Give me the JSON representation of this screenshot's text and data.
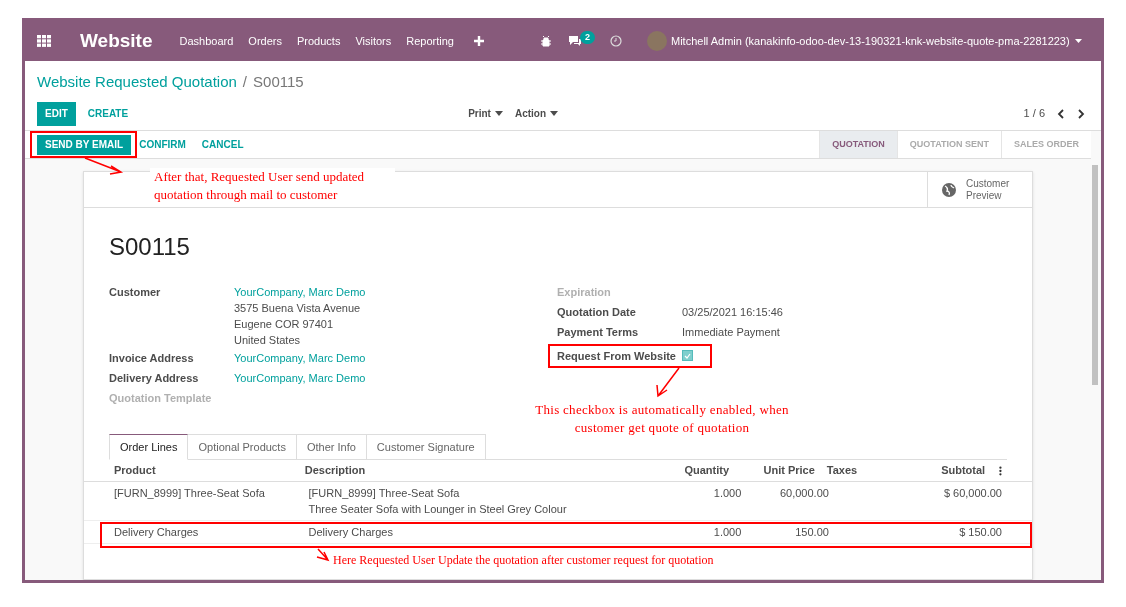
{
  "navbar": {
    "app_name": "Website",
    "menu": [
      "Dashboard",
      "Orders",
      "Products",
      "Visitors",
      "Reporting"
    ],
    "messages_count": "2",
    "user": "Mitchell Admin (kanakinfo-odoo-dev-13-190321-knk-website-quote-pma-2281223)"
  },
  "breadcrumb": {
    "parent": "Website Requested Quotation",
    "separator": "/",
    "current": "S00115"
  },
  "control_panel": {
    "primary": "EDIT",
    "secondary": "CREATE",
    "dropdowns": [
      "Print",
      "Action"
    ],
    "pager": "1 / 6"
  },
  "actions": [
    {
      "label": "SEND BY EMAIL",
      "kind": "primary"
    },
    {
      "label": "CONFIRM",
      "kind": "link"
    },
    {
      "label": "CANCEL",
      "kind": "link"
    }
  ],
  "status_steps": [
    {
      "label": "QUOTATION",
      "selected": true
    },
    {
      "label": "QUOTATION SENT",
      "selected": false
    },
    {
      "label": "SALES ORDER",
      "selected": false
    }
  ],
  "sheet": {
    "smart_button": "Customer Preview",
    "name": "S00115",
    "left_fields": [
      {
        "label": "Customer",
        "value": "YourCompany, Marc Demo",
        "address": [
          "3575 Buena Vista Avenue",
          "Eugene COR 97401",
          "United States"
        ],
        "kind": "link"
      },
      {
        "label": "Invoice Address",
        "value": "YourCompany, Marc Demo",
        "kind": "link"
      },
      {
        "label": "Delivery Address",
        "value": "YourCompany, Marc Demo",
        "kind": "link"
      },
      {
        "label": "Quotation Template",
        "kind": "empty"
      }
    ],
    "right_fields": [
      {
        "label": "Expiration",
        "kind": "empty"
      },
      {
        "label": "Quotation Date",
        "value": "03/25/2021 16:15:46",
        "kind": "text"
      },
      {
        "label": "Payment Terms",
        "value": "Immediate Payment",
        "kind": "text"
      },
      {
        "label": "Request From Website",
        "kind": "checkbox",
        "checked": true
      }
    ],
    "tabs": [
      {
        "label": "Order Lines",
        "selected": true
      },
      {
        "label": "Optional Products",
        "selected": false
      },
      {
        "label": "Other Info",
        "selected": false
      },
      {
        "label": "Customer Signature",
        "selected": false
      }
    ],
    "columns": [
      "Product",
      "Description",
      "Quantity",
      "Unit Price",
      "Taxes",
      "Subtotal"
    ],
    "rows": [
      {
        "product": "[FURN_8999] Three-Seat Sofa",
        "description": [
          "[FURN_8999] Three-Seat Sofa",
          "Three Seater Sofa with Lounger in Steel Grey Colour"
        ],
        "quantity": "1.000",
        "unit_price": "60,000.00",
        "subtotal": "$ 60,000.00"
      },
      {
        "product": "Delivery Charges",
        "description": [
          "Delivery Charges"
        ],
        "quantity": "1.000",
        "unit_price": "150.00",
        "subtotal": "$ 150.00"
      }
    ]
  },
  "annotations": [
    {
      "text": "After that, Requested User send updated quotation through mail to customer"
    },
    {
      "text": "This checkbox is automatically enabled, when customer get quote of quotation"
    },
    {
      "text": "Here Requested User Update the quotation after customer request for quotation"
    }
  ]
}
